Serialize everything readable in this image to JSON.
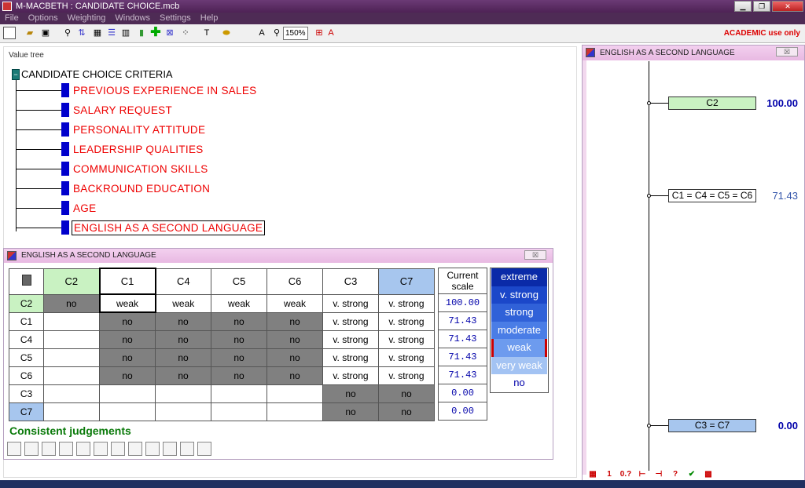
{
  "window": {
    "title": "M-MACBETH : CANDIDATE CHOICE.mcb"
  },
  "menu": [
    "File",
    "Options",
    "Weighting",
    "Windows",
    "Settings",
    "Help"
  ],
  "toolbar": {
    "zoom": "150%",
    "license": "ACADEMIC use only"
  },
  "value_tree": {
    "label": "Value tree",
    "root": "CANDIDATE CHOICE CRITERIA",
    "root_toggle": "−",
    "criteria": [
      "PREVIOUS EXPERIENCE IN SALES",
      "SALARY REQUEST",
      "PERSONALITY ATTITUDE",
      "LEADERSHIP QUALITIES",
      "COMMUNICATION SKILLS",
      "BACKROUND EDUCATION",
      "AGE",
      "ENGLISH AS A SECOND LANGUAGE"
    ]
  },
  "matrix_window": {
    "title": "ENGLISH AS A SECOND LANGUAGE",
    "close": "☒",
    "columns": [
      "C2",
      "C1",
      "C4",
      "C5",
      "C6",
      "C3",
      "C7"
    ],
    "rows": [
      {
        "label": "C2",
        "cells": [
          "no",
          "weak",
          "weak",
          "weak",
          "weak",
          "v. strong",
          "v. strong"
        ],
        "scale": "100.00"
      },
      {
        "label": "C1",
        "cells": [
          "",
          "no",
          "no",
          "no",
          "no",
          "v. strong",
          "v. strong"
        ],
        "scale": "71.43"
      },
      {
        "label": "C4",
        "cells": [
          "",
          "no",
          "no",
          "no",
          "no",
          "v. strong",
          "v. strong"
        ],
        "scale": "71.43"
      },
      {
        "label": "C5",
        "cells": [
          "",
          "no",
          "no",
          "no",
          "no",
          "v. strong",
          "v. strong"
        ],
        "scale": "71.43"
      },
      {
        "label": "C6",
        "cells": [
          "",
          "no",
          "no",
          "no",
          "no",
          "v. strong",
          "v. strong"
        ],
        "scale": "71.43"
      },
      {
        "label": "C3",
        "cells": [
          "",
          "",
          "",
          "",
          "",
          "no",
          "no"
        ],
        "scale": "0.00"
      },
      {
        "label": "C7",
        "cells": [
          "",
          "",
          "",
          "",
          "",
          "no",
          "no"
        ],
        "scale": "0.00"
      }
    ],
    "scale_header": "Current scale",
    "legend": [
      "extreme",
      "v. strong",
      "strong",
      "moderate",
      "weak",
      "very weak",
      "no"
    ],
    "status": "Consistent judgements"
  },
  "scale_window": {
    "title": "ENGLISH AS A SECOND LANGUAGE",
    "close": "☒",
    "levels": [
      {
        "label": "C2",
        "value": "100.00"
      },
      {
        "label": "C1 = C4 = C5 = C6",
        "value": "71.43"
      },
      {
        "label": "C3 = C7",
        "value": "0.00"
      }
    ]
  }
}
